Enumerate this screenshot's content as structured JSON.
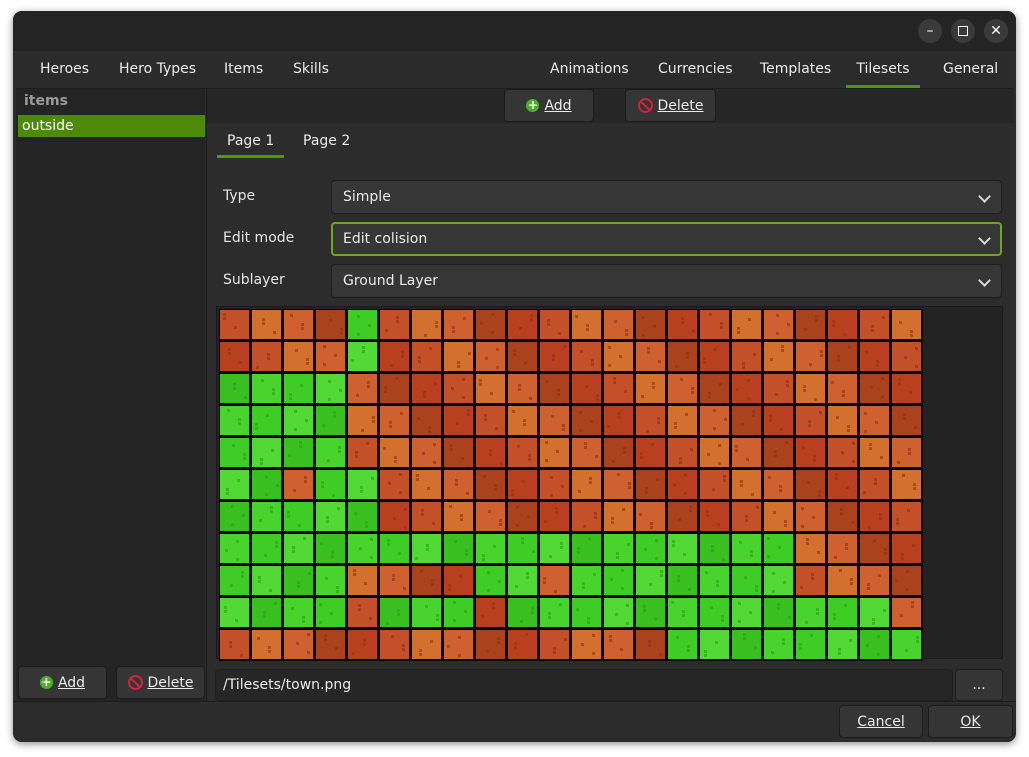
{
  "window": {
    "minimize_icon": "minimize-icon",
    "maximize_icon": "maximize-icon",
    "close_icon": "close-icon"
  },
  "menu": {
    "left_tabs": [
      "Heroes",
      "Hero Types",
      "Items",
      "Skills"
    ],
    "right_tabs": [
      "Animations",
      "Currencies",
      "Templates",
      "Tilesets",
      "General"
    ],
    "active_tab": "Tilesets"
  },
  "sidebar": {
    "header": "items",
    "items": [
      "outside"
    ],
    "selected": "outside",
    "add_label": "Add",
    "delete_label": "Delete"
  },
  "toolbar": {
    "add_label": "Add",
    "delete_label": "Delete"
  },
  "pages": {
    "tabs": [
      "Page 1",
      "Page 2"
    ],
    "active": "Page 1"
  },
  "form": {
    "type_label": "Type",
    "type_value": "Simple",
    "edit_mode_label": "Edit mode",
    "edit_mode_value": "Edit colision",
    "sublayer_label": "Sublayer",
    "sublayer_value": "Ground Layer"
  },
  "tileset": {
    "columns": 22,
    "rows": 11,
    "passable_color": "#44d12a",
    "blocked_color": "#c8502a",
    "path": "/Tilesets/town.png",
    "browse_label": "..."
  },
  "dialog": {
    "cancel_label": "Cancel",
    "ok_label": "OK"
  },
  "colors": {
    "accent": "#4e9a06",
    "selection": "#4e8a0a"
  }
}
